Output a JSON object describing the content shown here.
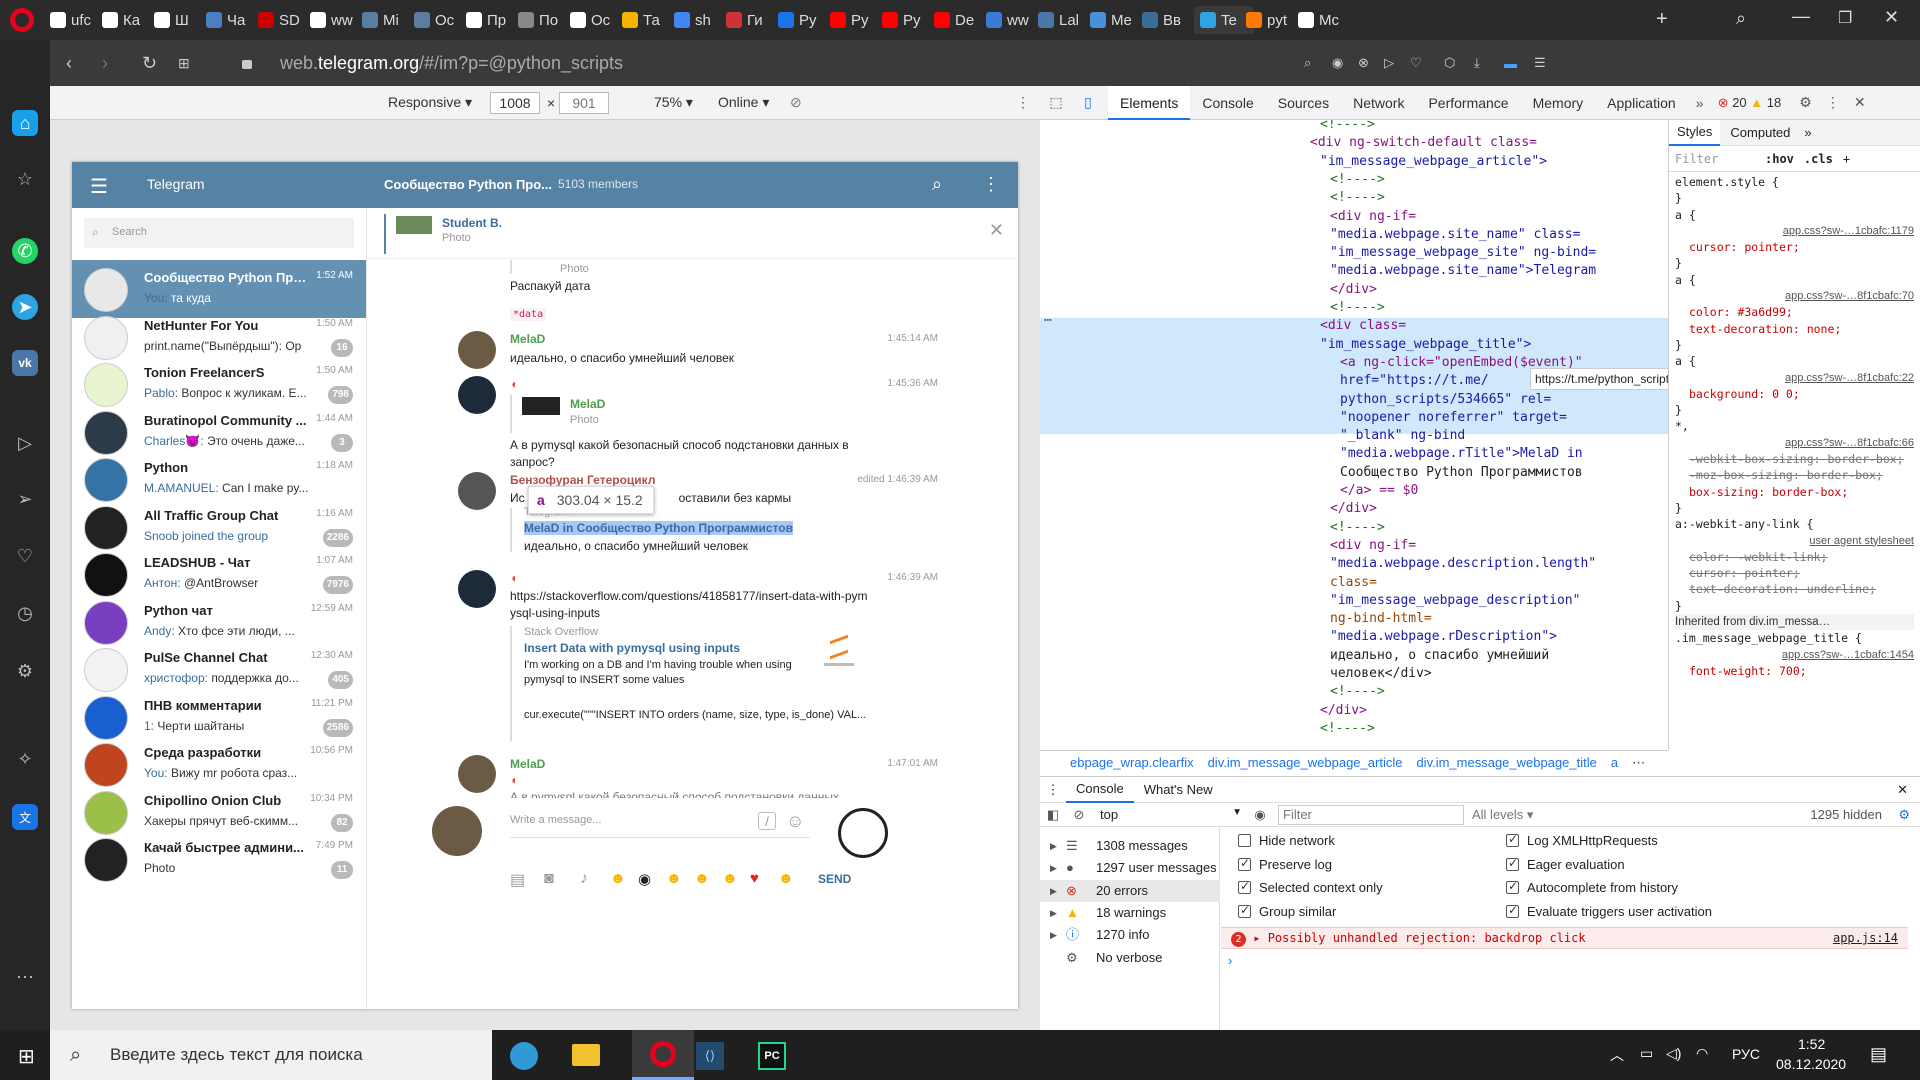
{
  "browser": {
    "tabs": [
      {
        "label": "ufc",
        "color": "#ffffff"
      },
      {
        "label": "Ка",
        "color": "#ffffff"
      },
      {
        "label": "Ш",
        "color": "#ffffff"
      },
      {
        "label": "Ча",
        "color": "#4a7fc1"
      },
      {
        "label": "SD",
        "color": "#cc0000"
      },
      {
        "label": "ww",
        "color": "#ffffff"
      },
      {
        "label": "Mi",
        "color": "#5a7fa3"
      },
      {
        "label": "Ос",
        "color": "#5a7fa3"
      },
      {
        "label": "Пр",
        "color": "#ffffff"
      },
      {
        "label": "По",
        "color": "#888888"
      },
      {
        "label": "Ос",
        "color": "#ffffff"
      },
      {
        "label": "Та",
        "color": "#f4b400"
      },
      {
        "label": "sh",
        "color": "#4285f4"
      },
      {
        "label": "Ги",
        "color": "#cc3333"
      },
      {
        "label": "Ру",
        "color": "#1a73e8"
      },
      {
        "label": "Py",
        "color": "#ff0000"
      },
      {
        "label": "Py",
        "color": "#ff0000"
      },
      {
        "label": "De",
        "color": "#ff0000"
      },
      {
        "label": "ww",
        "color": "#3a7bd5"
      },
      {
        "label": "Lal",
        "color": "#4a76a8"
      },
      {
        "label": "Me",
        "color": "#4a90d9"
      },
      {
        "label": "Вв",
        "color": "#3a6d99"
      },
      {
        "label": "Te",
        "color": "#2ca5e0"
      },
      {
        "label": "pyt",
        "color": "#ff7a00"
      },
      {
        "label": "Mc",
        "color": "#ffffff"
      }
    ],
    "url_prefix": "web.",
    "url_domain": "telegram.org",
    "url_suffix": "/#/im?p=@python_scripts"
  },
  "device": {
    "mode": "Responsive",
    "width": "1008",
    "height": "901",
    "zoom": "75%",
    "network": "Online"
  },
  "telegram": {
    "menu_title": "Telegram",
    "chat_title": "Сообщество Python Про...",
    "members": "5103 members",
    "search_placeholder": "Search",
    "dialogs": [
      {
        "name": "Сообщество Python Про...",
        "time": "1:52 AM",
        "sender": "You:",
        "preview": "та куда",
        "badge": "",
        "color": "#e8e8e8",
        "selected": true
      },
      {
        "name": "NetHunter For You",
        "time": "1:50 AM",
        "sender": "",
        "preview": "print.name(\"Выпёрдыш\"): Ор",
        "badge": "16",
        "color": "#f0f0f0"
      },
      {
        "name": "Tonion FreelancerS",
        "time": "1:50 AM",
        "sender": "Pablo:",
        "preview": "Вопрос к жуликам. Е...",
        "badge": "798",
        "color": "#e8f5d0"
      },
      {
        "name": "Buratinopol Community ...",
        "time": "1:44 AM",
        "sender": "Charles😈:",
        "preview": "Это очень даже...",
        "badge": "3",
        "color": "#2d3a4a"
      },
      {
        "name": "Python",
        "time": "1:18 AM",
        "sender": "M.AMANUEL:",
        "preview": "Can I make py...",
        "badge": "",
        "color": "#3572a5"
      },
      {
        "name": "All Traffic Group Chat",
        "time": "1:16 AM",
        "sender": "Snoob joined the group",
        "preview": "",
        "badge": "2286",
        "color": "#222222"
      },
      {
        "name": "LEADSHUB - Чат",
        "time": "1:07 AM",
        "sender": "Антон:",
        "preview": "@AntBrowser",
        "badge": "7976",
        "color": "#111111"
      },
      {
        "name": "Python чат",
        "time": "12:59 AM",
        "sender": "Andy:",
        "preview": "Хто фсе эти люди, ...",
        "badge": "",
        "color": "#7a3fc0"
      },
      {
        "name": "PulSe Channel Chat",
        "time": "12:30 AM",
        "sender": "христофор:",
        "preview": "поддержка до...",
        "badge": "405",
        "color": "#f3f3f3"
      },
      {
        "name": "ПНВ комментарии",
        "time": "11:21 PM",
        "sender": "1:",
        "preview": "Черти шайтаны",
        "badge": "2586",
        "color": "#1a5fd0"
      },
      {
        "name": "Среда разработки",
        "time": "10:56 PM",
        "sender": "You:",
        "preview": "Вижу mr робота сраз...",
        "badge": "",
        "color": "#c0451f"
      },
      {
        "name": "Chipollino Onion Club",
        "time": "10:34 PM",
        "sender": "",
        "preview": "Хакеры прячут веб-скимм...",
        "badge": "82",
        "color": "#9cbf4a"
      },
      {
        "name": "Качай быстрее админи...",
        "time": "7:49 PM",
        "sender": "",
        "preview": "Photo",
        "badge": "11",
        "color": "#222222"
      }
    ],
    "pinned": {
      "name": "Student B.",
      "sub": "Photo"
    },
    "messages": {
      "m0_photo": "Photo",
      "m0_text": "Распакуй дата",
      "m0_code": "*data",
      "m1_author": "MelaD",
      "m1_time": "1:45:14 AM",
      "m1_text": "идеально, о спасибо умнейший человек",
      "m2_time": "1:45:36 AM",
      "m2_qname": "MelaD",
      "m2_qsub": "Photo",
      "m2_text": "А в pymysql какой безопасный способ подстановки данных в запрос?",
      "m3_author": "Бензофуран Гетероцикл",
      "m3_time": "edited 1:46:39 AM",
      "m3_text_a": "Ис",
      "m3_text_b": "оставили без кармы",
      "m3_tooltip_tag": "a",
      "m3_tooltip_size": "303.04 × 15.2",
      "m3_site": "Telegram",
      "m3_link": "MelaD in Сообщество Python Программистов",
      "m3_desc": "идеально, о спасибо умнейший человек",
      "m4_time": "1:46:39 AM",
      "m4_url": "https://stackoverflow.com/questions/41858177/insert-data-with-pymysql-using-inputs",
      "m4_site": "Stack Overflow",
      "m4_title": "Insert Data with pymysql using inputs",
      "m4_desc": "I'm working on a DB and I'm having trouble when using pymysql to INSERT some values",
      "m4_code": "cur.execute(\"\"\"INSERT INTO orders (name, size, type, is_done) VAL...",
      "m5_author": "MelaD",
      "m5_time": "1:47:01 AM",
      "m5_text": "А в pymysql какой безопасный способ подстановки данных"
    },
    "compose_placeholder": "Write a message...",
    "send_label": "SEND"
  },
  "devtools": {
    "tabs": [
      "Elements",
      "Console",
      "Sources",
      "Network",
      "Performance",
      "Memory",
      "Application"
    ],
    "errors": "20",
    "warnings": "18",
    "html_lines": [
      "<!---->",
      "<div ng-switch-default class=",
      "\"im_message_webpage_article\">",
      "<!---->",
      "<!---->",
      "<div ng-if=",
      "\"media.webpage.site_name\" class=",
      "\"im_message_webpage_site\" ng-bind=",
      "\"media.webpage.site_name\">Telegram",
      "</div>",
      "<!---->",
      "<div class=",
      "\"im_message_webpage_title\">",
      "<a ng-click=\"openEmbed($event)\"",
      "href=\"https://t.me/",
      "python_scripts/534665\" rel=",
      "\"noopener noreferrer\" target=",
      "\"_blank\" ng-bind",
      "\"media.webpage.rTitle\">MelaD in",
      "Сообщество Python Программистов",
      "</a> == $0",
      "</div>",
      "<!---->",
      "<div ng-if=",
      "\"media.webpage.description.length\"",
      "class=",
      "\"im_message_webpage_description\"",
      "ng-bind-html=",
      "\"media.webpage.rDescription\">",
      "идеально, о спасибо умнейший",
      "человек</div>",
      "<!---->",
      "</div>",
      "<!---->"
    ],
    "hover_url": "https://t.me/python_scripts/534665",
    "styles_tabs": [
      "Styles",
      "Computed"
    ],
    "styles_filter": "Filter",
    "hov": ":hov",
    ".cls": ".cls",
    "style_rules": [
      "element.style {",
      "}",
      "a {",
      "app.css?sw-…1cbafc:1179",
      "cursor: pointer;",
      "}",
      "a {",
      "app.css?sw-…8f1cbafc:70",
      "color: #3a6d99;",
      "text-decoration: none;",
      "}",
      "a {",
      "app.css?sw-…8f1cbafc:22",
      "background: 0 0;",
      "}",
      "*,",
      "app.css?sw-…8f1cbafc:66",
      "-webkit-box-sizing: border-box;",
      "-moz-box-sizing: border-box;",
      "box-sizing: border-box;",
      "}",
      "a:-webkit-any-link {",
      "user agent stylesheet",
      "color: -webkit-link;",
      "cursor: pointer;",
      "text-decoration: underline;",
      "}",
      "Inherited from div.im_messa…",
      ".im_message_webpage_title {",
      "app.css?sw-…1cbafc:1454",
      "font-weight: 700;"
    ],
    "crumbs": [
      "ebpage_wrap.clearfix",
      "div.im_message_webpage_article",
      "div.im_message_webpage_title",
      "a"
    ],
    "drawer_tabs": [
      "Console",
      "What's New"
    ],
    "context": "top",
    "filter_placeholder": "Filter",
    "levels": "All levels",
    "hidden": "1295 hidden",
    "sidebar_items": [
      {
        "label": "1308 messages",
        "icon": "list-icon"
      },
      {
        "label": "1297 user messages",
        "icon": "user-icon"
      },
      {
        "label": "20 errors",
        "icon": "error-icon"
      },
      {
        "label": "18 warnings",
        "icon": "warning-icon"
      },
      {
        "label": "1270 info",
        "icon": "info-icon"
      },
      {
        "label": "No verbose",
        "icon": "gear-icon"
      }
    ],
    "options_left": [
      {
        "label": "Hide network",
        "checked": false
      },
      {
        "label": "Preserve log",
        "checked": true
      },
      {
        "label": "Selected context only",
        "checked": true
      },
      {
        "label": "Group similar",
        "checked": true
      }
    ],
    "options_right": [
      {
        "label": "Log XMLHttpRequests",
        "checked": true
      },
      {
        "label": "Eager evaluation",
        "checked": true
      },
      {
        "label": "Autocomplete from history",
        "checked": true
      },
      {
        "label": "Evaluate triggers user activation",
        "checked": true
      }
    ],
    "error_count": "2",
    "error_text": "Possibly unhandled rejection: backdrop click",
    "error_src": "app.js:14"
  },
  "taskbar": {
    "search_placeholder": "Введите здесь текст для поиска",
    "lang": "РУС",
    "time": "1:52",
    "date": "08.12.2020"
  }
}
